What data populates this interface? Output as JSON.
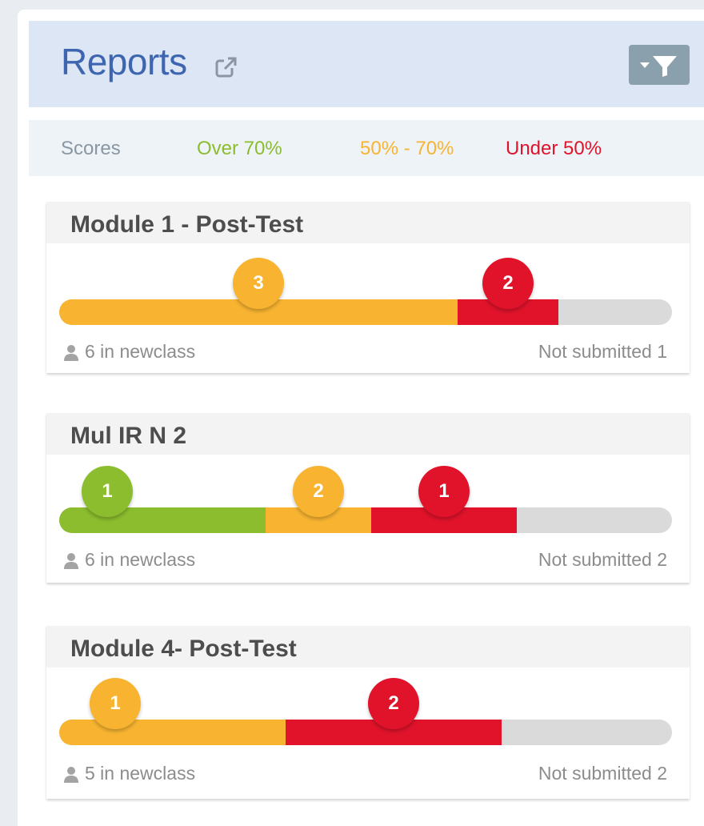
{
  "header": {
    "title": "Reports",
    "ext_icon": "external-link-icon",
    "filter_icon": "filter-icon"
  },
  "legend": {
    "label": "Scores",
    "over": "Over 70%",
    "mid": "50% - 70%",
    "under": "Under 50%",
    "colors": {
      "over": "#8bbd2e",
      "mid": "#f8b431",
      "under": "#e0132b",
      "none": "#dadada"
    }
  },
  "reports": [
    {
      "title": "Module 1 - Post-Test",
      "class_info": "6 in newclass",
      "not_submitted": "Not submitted 1",
      "segments": [
        {
          "band": "mid",
          "count": "3",
          "fraction": 0.65
        },
        {
          "band": "under",
          "count": "2",
          "fraction": 0.165
        }
      ]
    },
    {
      "title": "Mul IR N 2",
      "class_info": "6 in newclass",
      "not_submitted": "Not submitted 2",
      "segments": [
        {
          "band": "over",
          "count": "1",
          "fraction": 0.337
        },
        {
          "band": "mid",
          "count": "2",
          "fraction": 0.172
        },
        {
          "band": "under",
          "count": "1",
          "fraction": 0.238
        }
      ]
    },
    {
      "title": "Module 4- Post-Test",
      "class_info": "5 in newclass",
      "not_submitted": "Not submitted 2",
      "segments": [
        {
          "band": "mid",
          "count": "1",
          "fraction": 0.37
        },
        {
          "band": "under",
          "count": "2",
          "fraction": 0.353
        }
      ]
    }
  ]
}
